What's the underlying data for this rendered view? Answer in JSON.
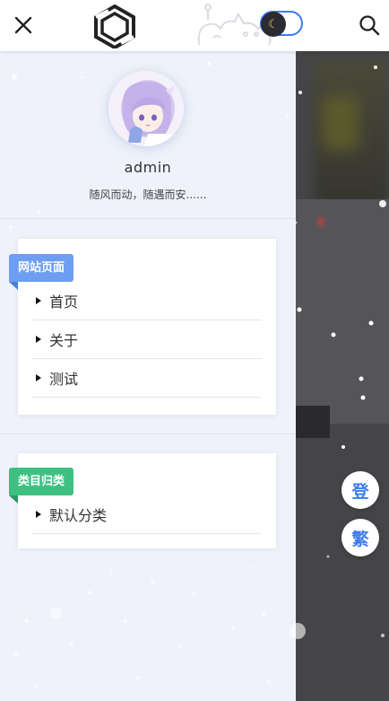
{
  "header": {
    "close_icon": "close-icon",
    "logo_icon": "hexagon-logo-icon",
    "theme_toggle_icon": "moon-icon",
    "search_icon": "search-icon"
  },
  "profile": {
    "username": "admin",
    "motto": "随风而动，随遇而安......"
  },
  "sections": [
    {
      "tag": "网站页面",
      "tag_color": "#6d9ef2",
      "items": [
        "首页",
        "关于",
        "测试"
      ]
    },
    {
      "tag": "类目归类",
      "tag_color": "#3fc083",
      "items": [
        "默认分类"
      ]
    }
  ],
  "floating": {
    "login_label": "登",
    "traditional_label": "繁"
  },
  "colors": {
    "accent": "#3d7bf0",
    "drawer_bg": "#eff2fa",
    "overlay": "#454548"
  }
}
